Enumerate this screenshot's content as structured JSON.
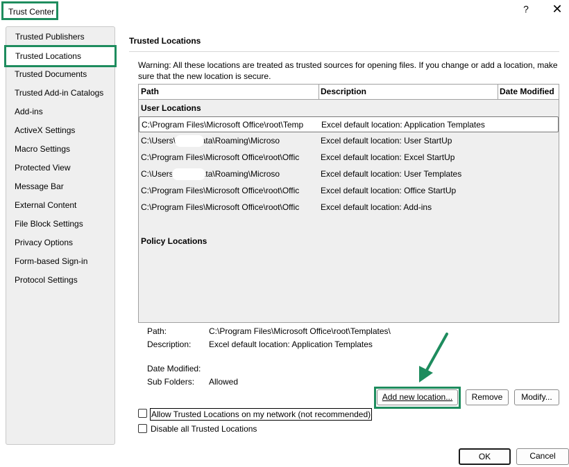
{
  "window": {
    "title": "Trust Center",
    "help_glyph": "?",
    "close_glyph": "✕"
  },
  "sidebar": {
    "items": [
      {
        "label": "Trusted Publishers"
      },
      {
        "label": "Trusted Locations"
      },
      {
        "label": "Trusted Documents"
      },
      {
        "label": "Trusted Add-in Catalogs"
      },
      {
        "label": "Add-ins"
      },
      {
        "label": "ActiveX Settings"
      },
      {
        "label": "Macro Settings"
      },
      {
        "label": "Protected View"
      },
      {
        "label": "Message Bar"
      },
      {
        "label": "External Content"
      },
      {
        "label": "File Block Settings"
      },
      {
        "label": "Privacy Options"
      },
      {
        "label": "Form-based Sign-in"
      },
      {
        "label": "Protocol Settings"
      }
    ],
    "selected_index": 1
  },
  "main": {
    "section_title": "Trusted Locations",
    "warning": "Warning: All these locations are treated as trusted sources for opening files.  If you change or add a location, make sure that the new location is secure.",
    "columns": [
      "Path",
      "Description",
      "Date Modified"
    ],
    "user_group_label": "User Locations",
    "policy_group_label": "Policy Locations",
    "rows": [
      {
        "path": "C:\\Program Files\\Microsoft Office\\root\\Temp",
        "description": "Excel default location: Application Templates"
      },
      {
        "path": "C:\\Users\\          \\AppData\\Roaming\\Microso",
        "description": "Excel default location: User StartUp"
      },
      {
        "path": "C:\\Program Files\\Microsoft Office\\root\\Offic",
        "description": "Excel default location: Excel StartUp"
      },
      {
        "path": "C:\\Users\\          \\AppData\\Roaming\\Microso",
        "description": "Excel default location: User Templates"
      },
      {
        "path": "C:\\Program Files\\Microsoft Office\\root\\Offic",
        "description": "Excel default location: Office StartUp"
      },
      {
        "path": "C:\\Program Files\\Microsoft Office\\root\\Offic",
        "description": "Excel default location: Add-ins"
      }
    ],
    "details": {
      "path_label": "Path:",
      "path_value": "C:\\Program Files\\Microsoft Office\\root\\Templates\\",
      "description_label": "Description:",
      "description_value": "Excel default location: Application Templates",
      "date_modified_label": "Date Modified:",
      "date_modified_value": "",
      "sub_folders_label": "Sub Folders:",
      "sub_folders_value": "Allowed"
    },
    "buttons": {
      "add_new_location": "Add new location...",
      "remove": "Remove",
      "modify": "Modify..."
    },
    "checkboxes": {
      "allow_network": {
        "label": "Allow Trusted Locations on my network (not recommended)",
        "checked": false
      },
      "disable_all": {
        "label": "Disable all Trusted Locations",
        "checked": false
      }
    }
  },
  "footer": {
    "ok": "OK",
    "cancel": "Cancel"
  },
  "colors": {
    "highlight": "#1e8c5e"
  },
  "icons": {
    "arrow": "arrow-pointer-icon"
  }
}
